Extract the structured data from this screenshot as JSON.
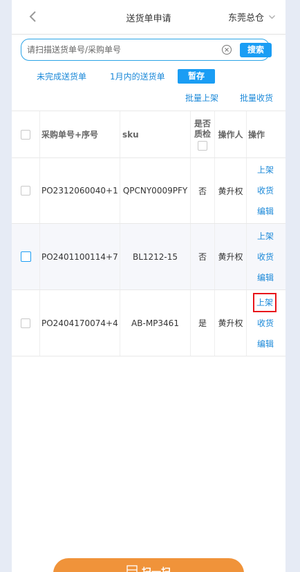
{
  "header": {
    "title": "送货单申请",
    "org": "东莞总仓"
  },
  "search": {
    "placeholder": "请扫描送货单号/采购单号",
    "button": "搜索"
  },
  "filters": {
    "incomplete": "未完成送货单",
    "january": "1月内的送货单",
    "draft": "暂存"
  },
  "batch": {
    "shelve": "批量上架",
    "receive": "批量收货"
  },
  "table": {
    "headers": {
      "po": "采购单号+序号",
      "sku": "sku",
      "qc_line1": "是否",
      "qc_line2": "质检",
      "operator": "操作人",
      "actions": "操作"
    },
    "actions": {
      "shelve": "上架",
      "receive": "收货",
      "edit": "编辑"
    },
    "rows": [
      {
        "po": "PO2312060040+1",
        "sku": "QPCNY0009PFY",
        "qc": "否",
        "operator": "黄升权"
      },
      {
        "po": "PO2401100114+7",
        "sku": "BL1212-15",
        "qc": "否",
        "operator": "黄升权"
      },
      {
        "po": "PO2404170074+4",
        "sku": "AB-MP3461",
        "qc": "是",
        "operator": "黄升权"
      }
    ]
  },
  "scan": {
    "label": "扫一扫"
  },
  "colors": {
    "accent": "#1a9df4",
    "link": "#1a88d8",
    "scan": "#f0933a",
    "highlight": "#e8141a"
  }
}
